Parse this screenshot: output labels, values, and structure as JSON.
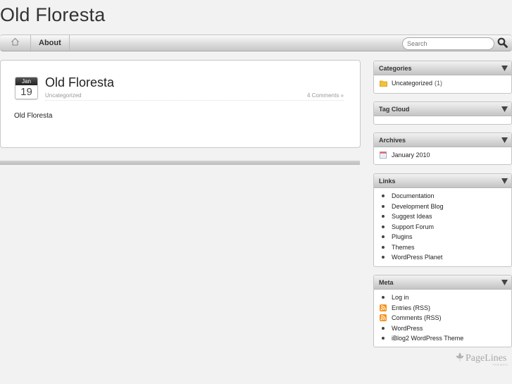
{
  "site": {
    "title": "Old Floresta"
  },
  "nav": {
    "home_icon": "home-icon",
    "about_label": "About",
    "search_placeholder": "Search",
    "search_icon": "magnifier-icon"
  },
  "post": {
    "date_month": "Jan",
    "date_day": "19",
    "title": "Old Floresta",
    "category": "Uncategorized",
    "comments": "4 Comments »",
    "body": "Old Floresta"
  },
  "sidebar": {
    "categories": {
      "title": "Categories",
      "items": [
        {
          "label": "Uncategorized",
          "count": "(1)",
          "icon": "folder-icon"
        }
      ]
    },
    "tag_cloud": {
      "title": "Tag Cloud"
    },
    "archives": {
      "title": "Archives",
      "items": [
        {
          "label": "January 2010",
          "icon": "calendar-icon"
        }
      ]
    },
    "links": {
      "title": "Links",
      "items": [
        "Documentation",
        "Development Blog",
        "Suggest Ideas",
        "Support Forum",
        "Plugins",
        "Themes",
        "WordPress Planet"
      ]
    },
    "meta": {
      "title": "Meta",
      "items": [
        {
          "label": "Log in",
          "icon": "bullet"
        },
        {
          "label": "Entries (RSS)",
          "icon": "rss-icon"
        },
        {
          "label": "Comments (RSS)",
          "icon": "rss-icon"
        },
        {
          "label": "WordPress",
          "icon": "bullet"
        },
        {
          "label": "iBlog2 WordPress Theme",
          "icon": "bullet"
        }
      ]
    }
  },
  "footer": {
    "brand": "PageLines",
    "brand_sub": "THEMES"
  },
  "colors": {
    "rss": "#f7931e",
    "folder": "#f4c430",
    "accent_dark": "#333333"
  }
}
